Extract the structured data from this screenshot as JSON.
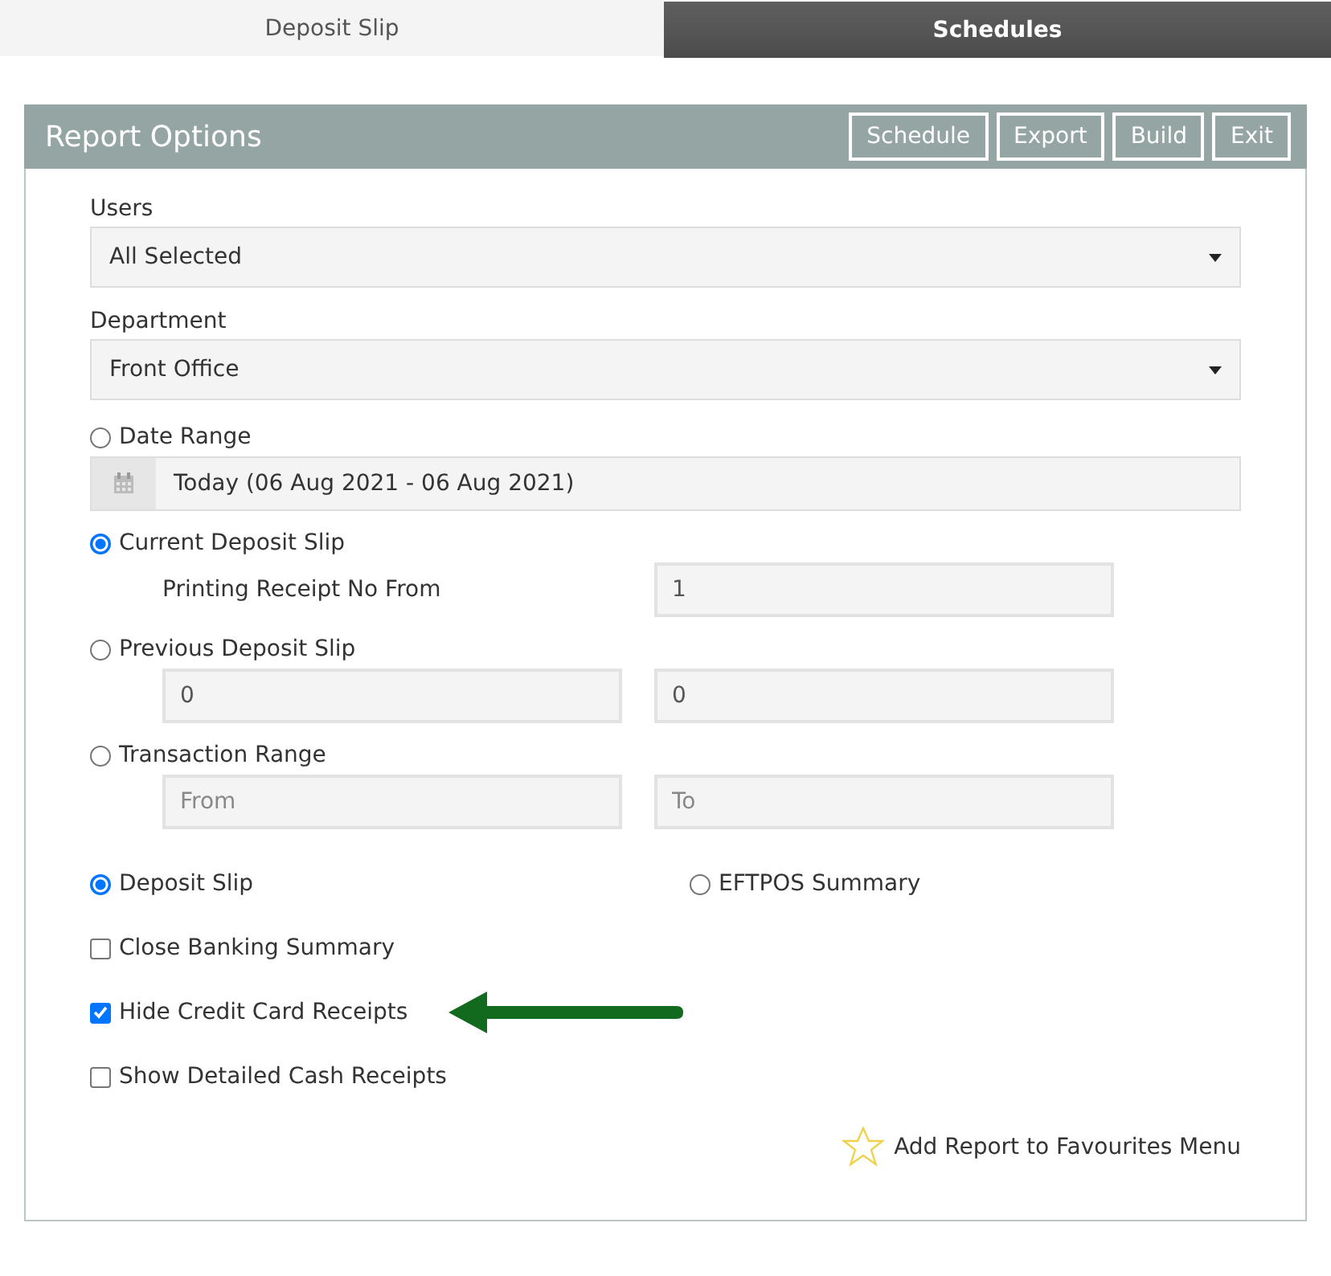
{
  "tabs": [
    {
      "label": "Deposit Slip",
      "selected": true
    },
    {
      "label": "Schedules",
      "selected": false
    }
  ],
  "panel": {
    "title": "Report Options",
    "buttons": [
      "Schedule",
      "Export",
      "Build",
      "Exit"
    ]
  },
  "selects": [
    {
      "label": "Users",
      "value": "All Selected"
    },
    {
      "label": "Department",
      "value": "Front Office"
    }
  ],
  "range_options": [
    {
      "kind": "date",
      "label": "Date Range",
      "selected": false,
      "value": "Today (06 Aug 2021 - 06 Aug 2021)"
    },
    {
      "kind": "receipt",
      "label": "Current Deposit Slip",
      "selected": true,
      "field_label": "Printing Receipt No From",
      "value": "1"
    },
    {
      "kind": "pair",
      "label": "Previous Deposit Slip",
      "selected": false,
      "fields": [
        {
          "value": "0"
        },
        {
          "value": "0"
        }
      ]
    },
    {
      "kind": "pair",
      "label": "Transaction Range",
      "selected": false,
      "fields": [
        {
          "placeholder": "From"
        },
        {
          "placeholder": "To"
        }
      ]
    }
  ],
  "report_types": [
    {
      "label": "Deposit Slip",
      "selected": true
    },
    {
      "label": "EFTPOS Summary",
      "selected": false
    }
  ],
  "checkboxes": [
    {
      "label": "Close Banking Summary",
      "checked": false
    },
    {
      "label": "Hide Credit Card Receipts",
      "checked": true
    },
    {
      "label": "Show Detailed Cash Receipts",
      "checked": false
    }
  ],
  "favourites": {
    "label": "Add Report to Favourites Menu"
  }
}
